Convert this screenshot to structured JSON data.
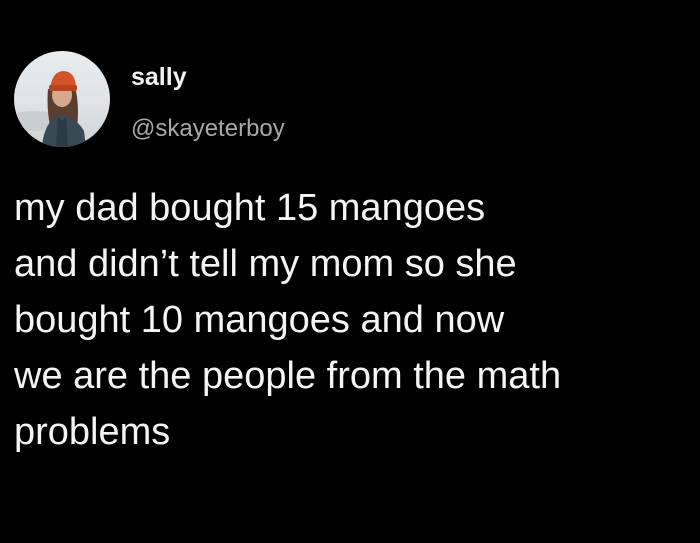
{
  "tweet": {
    "author": {
      "display_name": "sally",
      "handle": "@skayeterboy",
      "avatar_icon": "user-photo-avatar"
    },
    "text_lines": [
      "my dad bought 15 mangoes",
      "and didn’t tell my mom so she",
      "bought 10 mangoes and now",
      "we are the people from the math",
      "problems"
    ]
  },
  "colors": {
    "background": "#000000",
    "text": "#f4f4f4",
    "handle": "#a8a8a8"
  }
}
